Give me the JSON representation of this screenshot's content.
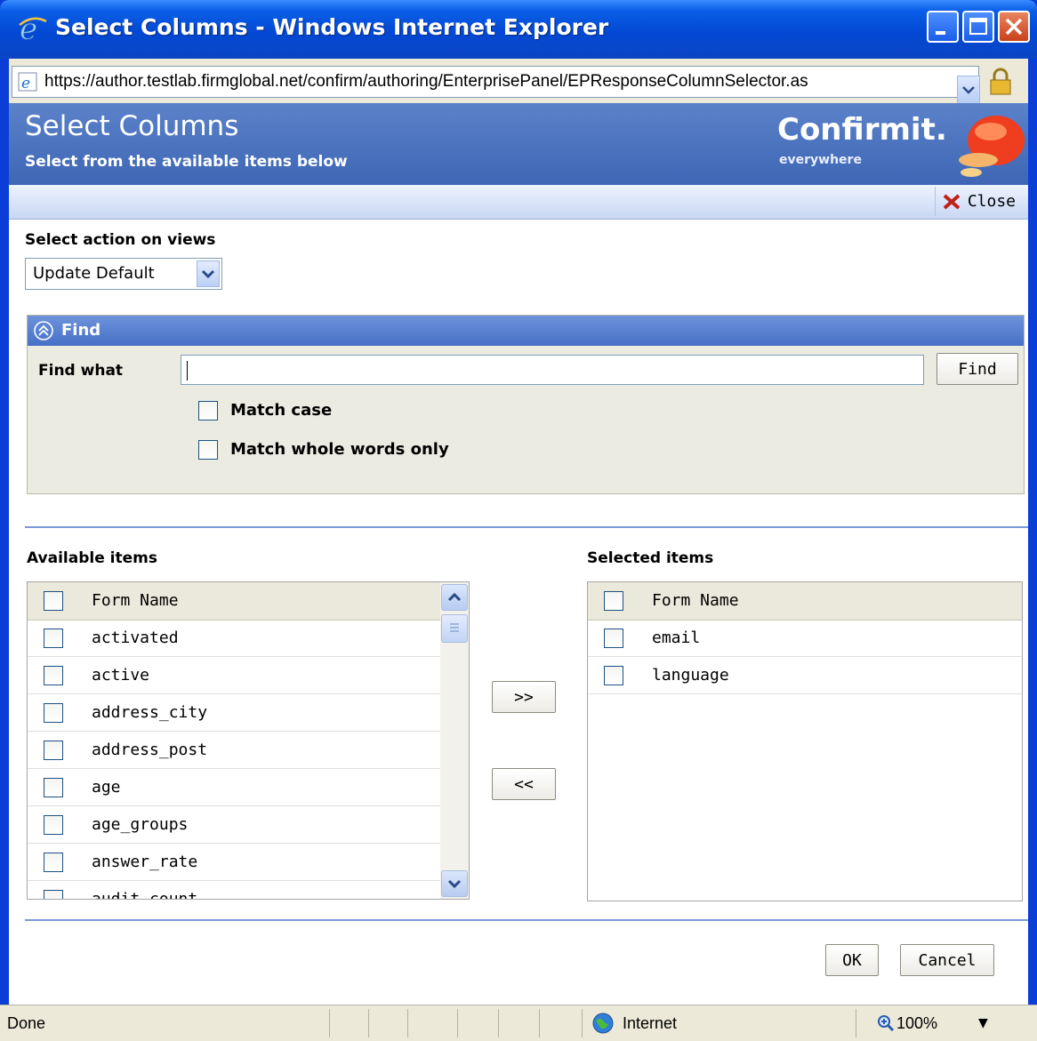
{
  "window": {
    "title": "Select Columns - Windows Internet Explorer",
    "url": "https://author.testlab.firmglobal.net/confirm/authoring/EnterprisePanel/EPResponseColumnSelector.as"
  },
  "header": {
    "title": "Select Columns",
    "subtitle": "Select from the available items below",
    "brand": "Confirmit.",
    "brand_tagline": "everywhere"
  },
  "toolbar": {
    "close_label": "Close"
  },
  "views": {
    "label": "Select action on views",
    "selected": "Update Default"
  },
  "find": {
    "header": "Find",
    "label": "Find what",
    "value": "",
    "button": "Find",
    "match_case": "Match case",
    "match_whole_words": "Match whole words only"
  },
  "available": {
    "heading": "Available items",
    "column": "Form Name",
    "items": [
      "activated",
      "active",
      "address_city",
      "address_post",
      "age",
      "age_groups",
      "answer_rate",
      "audit_count"
    ]
  },
  "selected": {
    "heading": "Selected items",
    "column": "Form Name",
    "items": [
      "email",
      "language"
    ]
  },
  "transfer": {
    "add": ">>",
    "remove": "<<"
  },
  "footer": {
    "ok": "OK",
    "cancel": "Cancel"
  },
  "status": {
    "text": "Done",
    "zone": "Internet",
    "zoom": "100%"
  },
  "colors": {
    "titlebar": "#0348d4",
    "header_band": "#4a71bd",
    "find_header": "#5a82d0",
    "separator": "#7c9bd6"
  }
}
